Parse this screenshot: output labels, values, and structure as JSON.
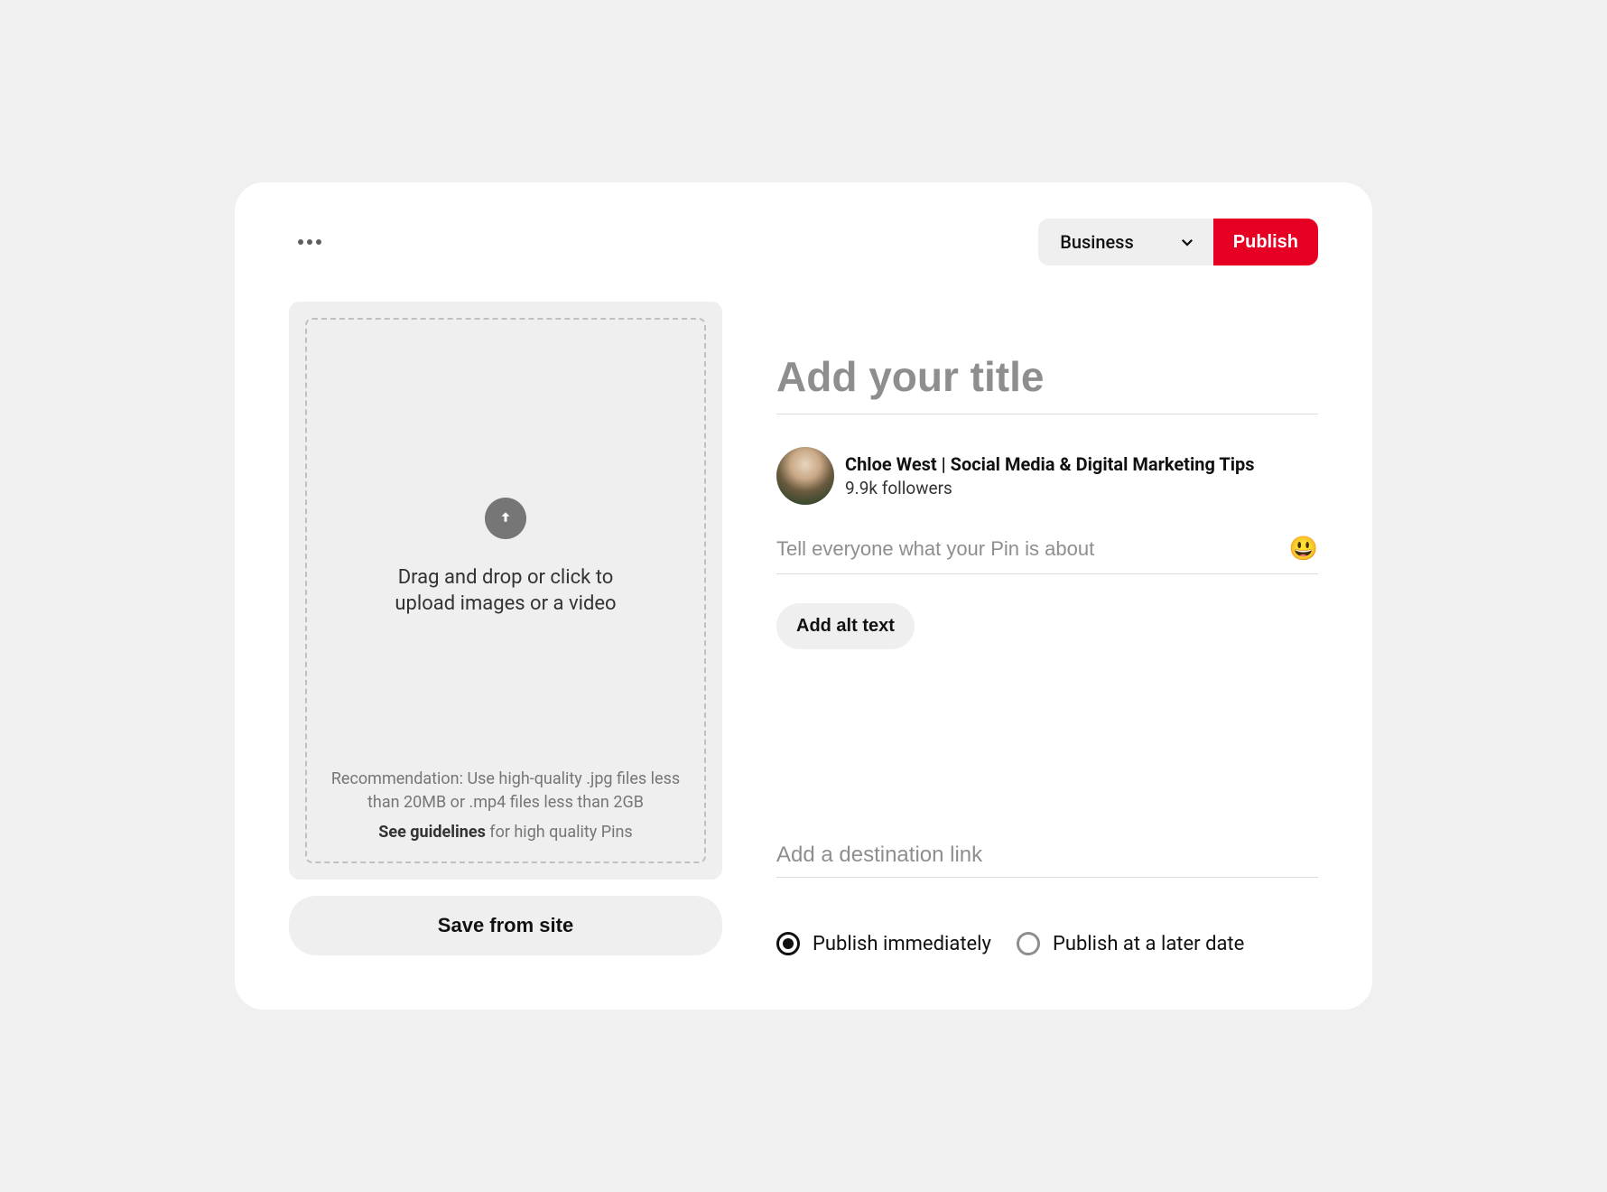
{
  "topbar": {
    "board_selected": "Business",
    "publish_label": "Publish"
  },
  "upload": {
    "main_text": "Drag and drop or click to upload images or a video",
    "recommendation": "Recommendation: Use high-quality .jpg files less than 20MB or .mp4 files less than 2GB",
    "guidelines_bold": "See guidelines",
    "guidelines_rest": " for high quality Pins",
    "save_from_site": "Save from site"
  },
  "form": {
    "title_placeholder": "Add your title",
    "desc_placeholder": "Tell everyone what your Pin is about",
    "alt_text_label": "Add alt text",
    "link_placeholder": "Add a destination link"
  },
  "profile": {
    "name": "Chloe West | Social Media & Digital Marketing Tips",
    "followers": "9.9k followers"
  },
  "schedule": {
    "immediate": "Publish immediately",
    "later": "Publish at a later date"
  },
  "icons": {
    "emoji": "😃"
  }
}
